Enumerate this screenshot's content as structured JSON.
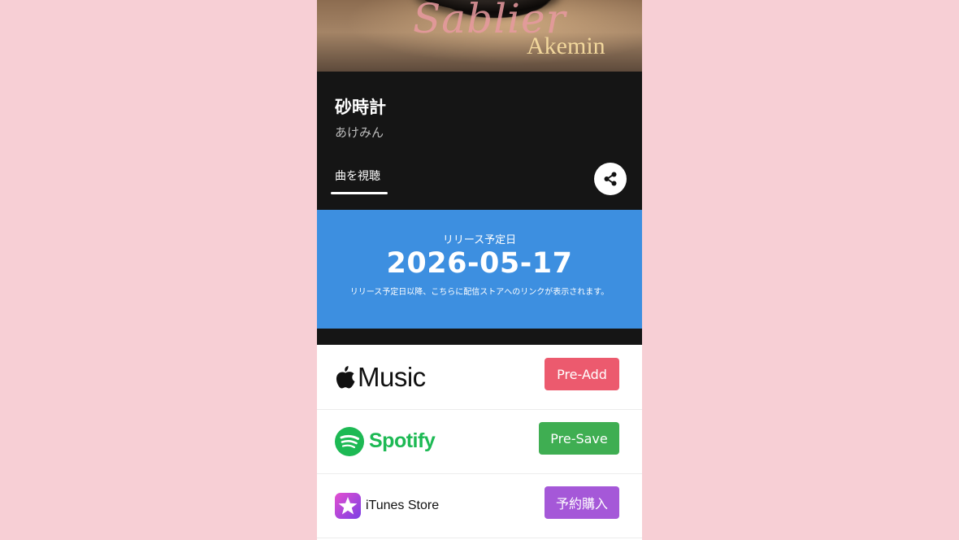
{
  "cover": {
    "script_text": "Sablier",
    "artist_logo": "Akemin"
  },
  "song": {
    "title": "砂時計",
    "artist": "あけみん"
  },
  "tabs": [
    {
      "label": "曲を視聴",
      "active": true
    }
  ],
  "share": {
    "icon": "share-icon"
  },
  "release": {
    "label": "リリース予定日",
    "date": "2026-05-17",
    "note": "リリース予定日以降、こちらに配信ストアへのリンクが表示されます。"
  },
  "stores": [
    {
      "name": "Music",
      "icon": "apple-logo-icon",
      "button": "Pre-Add",
      "button_color": "#ec5a6e"
    },
    {
      "name": "Spotify",
      "icon": "spotify-logo-icon",
      "button": "Pre-Save",
      "button_color": "#3fae52"
    },
    {
      "name": "iTunes Store",
      "icon": "itunes-star-icon",
      "button": "予約購入",
      "button_color": "#a558d8"
    }
  ],
  "colors": {
    "banner": "#3d8fe0",
    "background": "#f7cfd5",
    "dark": "#151515"
  }
}
